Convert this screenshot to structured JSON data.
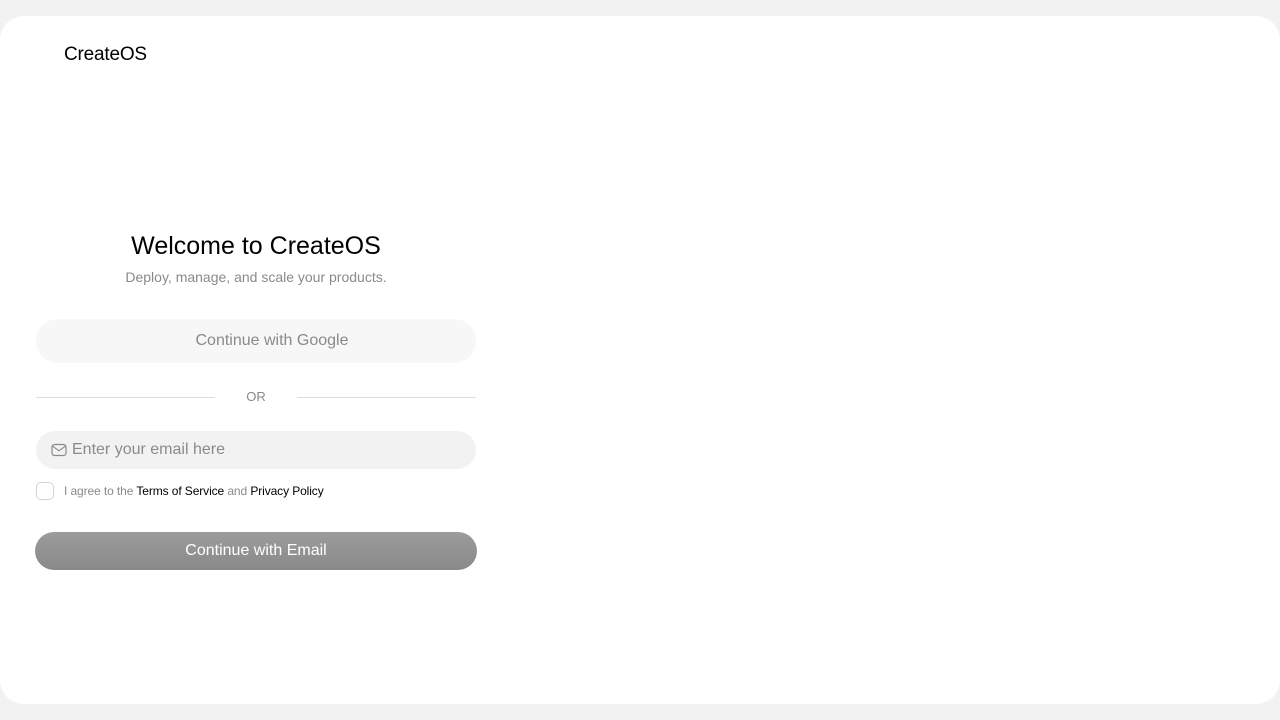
{
  "brand": {
    "name": "CreateOS"
  },
  "login": {
    "title": "Welcome to CreateOS",
    "subtitle": "Deploy, manage, and scale your products.",
    "google_button_label": "Continue with Google",
    "divider_label": "OR",
    "email_placeholder": "Enter your email here",
    "email_value": "",
    "agree_prefix": "I agree to the",
    "terms_label": "Terms of Service",
    "agree_and": "and",
    "privacy_label": "Privacy Policy",
    "agree_checked": false,
    "email_button_label": "Continue with Email"
  },
  "icons": {
    "email_icon": "mail-envelope-icon"
  },
  "colors": {
    "background": "#f2f2f2",
    "card": "#ffffff",
    "muted_text": "#8a8a8a",
    "primary_button": "#919191"
  }
}
